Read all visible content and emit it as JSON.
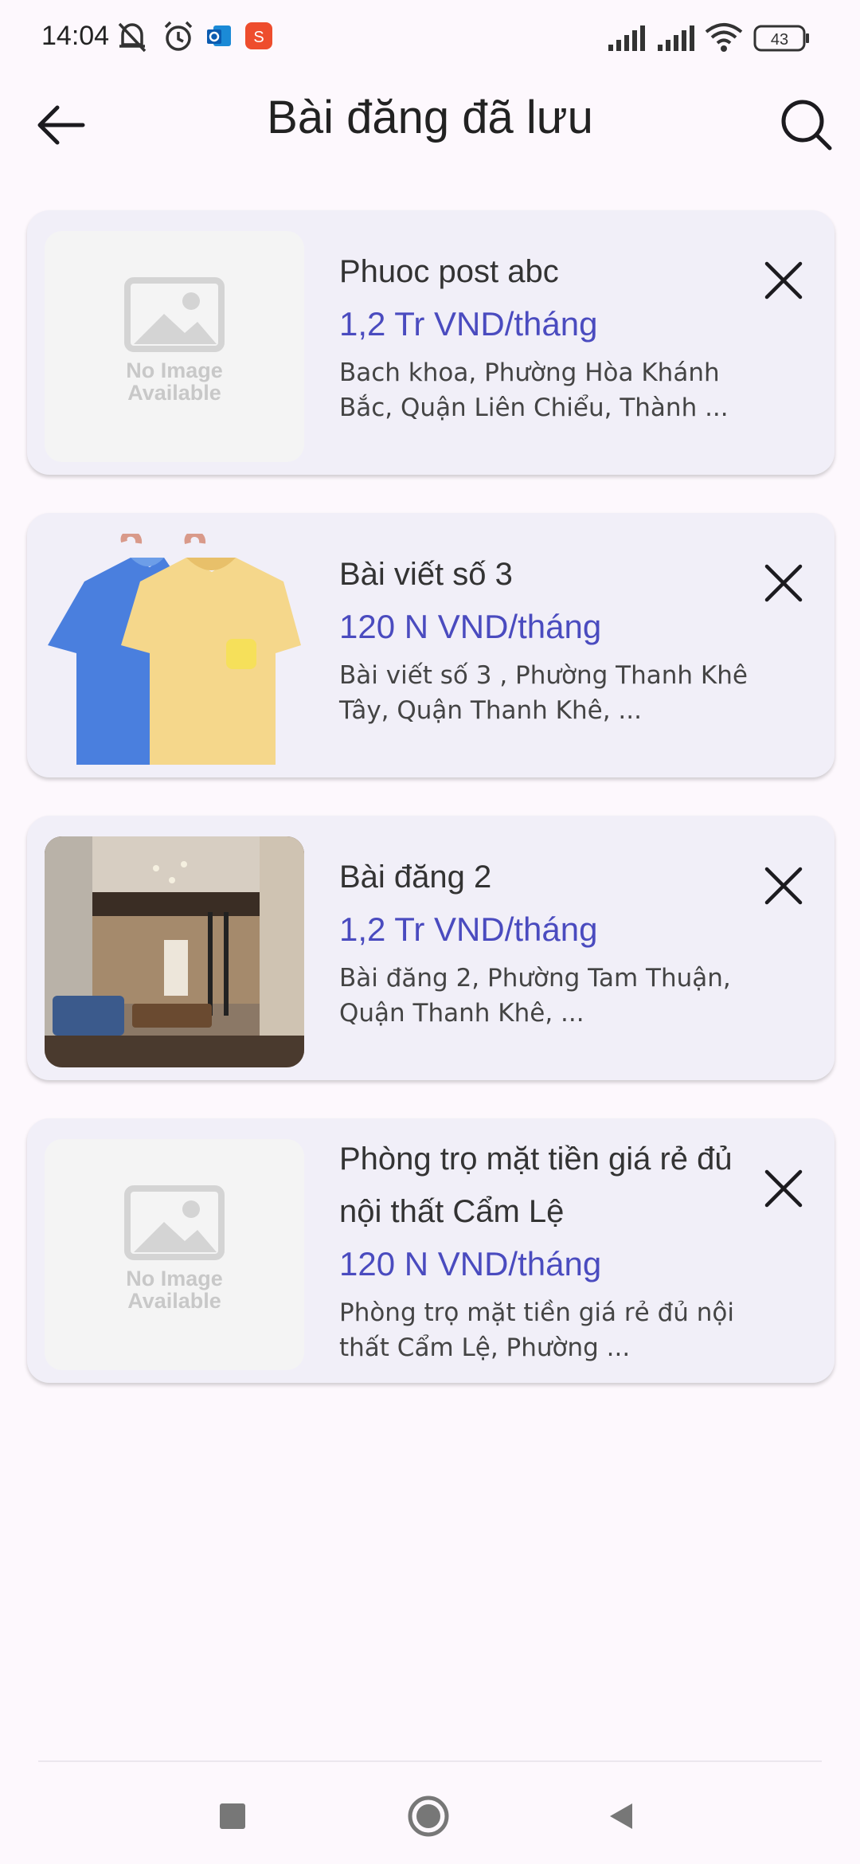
{
  "status_bar": {
    "time": "14:04",
    "battery": "43",
    "icons": [
      "muted-bell-icon",
      "alarm-icon",
      "outlook-icon",
      "shopee-icon",
      "signal-icon",
      "signal-icon",
      "wifi-icon",
      "battery-icon"
    ]
  },
  "header": {
    "title": "Bài đăng đã lưu",
    "back_icon": "arrow-left-icon",
    "search_icon": "search-icon"
  },
  "saved_posts": [
    {
      "title": "Phuoc post abc",
      "price": "1,2 Tr VND/tháng",
      "address": "Bach khoa, Phường Hòa Khánh Bắc, Quận Liên Chiểu, Thành ...",
      "image": "no-image-placeholder",
      "placeholder_line1": "No Image",
      "placeholder_line2": "Available"
    },
    {
      "title": "Bài viết số 3",
      "price": "120 N VND/tháng",
      "address": "Bài viết số 3 , Phường Thanh Khê Tây, Quận Thanh Khê, ...",
      "image": "tshirts-photo"
    },
    {
      "title": "Bài đăng 2",
      "price": "1,2 Tr VND/tháng",
      "address": "Bài đăng 2, Phường Tam Thuận, Quận Thanh Khê, ...",
      "image": "loft-room-photo"
    },
    {
      "title": "Phòng trọ mặt tiền giá rẻ đủ nội thất Cẩm Lệ",
      "price": "120 N VND/tháng",
      "address": "Phòng trọ mặt tiền giá rẻ đủ nội thất Cẩm Lệ, Phường ...",
      "image": "no-image-placeholder",
      "placeholder_line1": "No Image",
      "placeholder_line2": "Available"
    }
  ],
  "colors": {
    "background": "#fdf8fd",
    "card": "#f1eff8",
    "price": "#4a4bbf"
  },
  "nav_bar": {
    "buttons": [
      "recents-square-icon",
      "home-circle-icon",
      "back-triangle-icon"
    ]
  }
}
